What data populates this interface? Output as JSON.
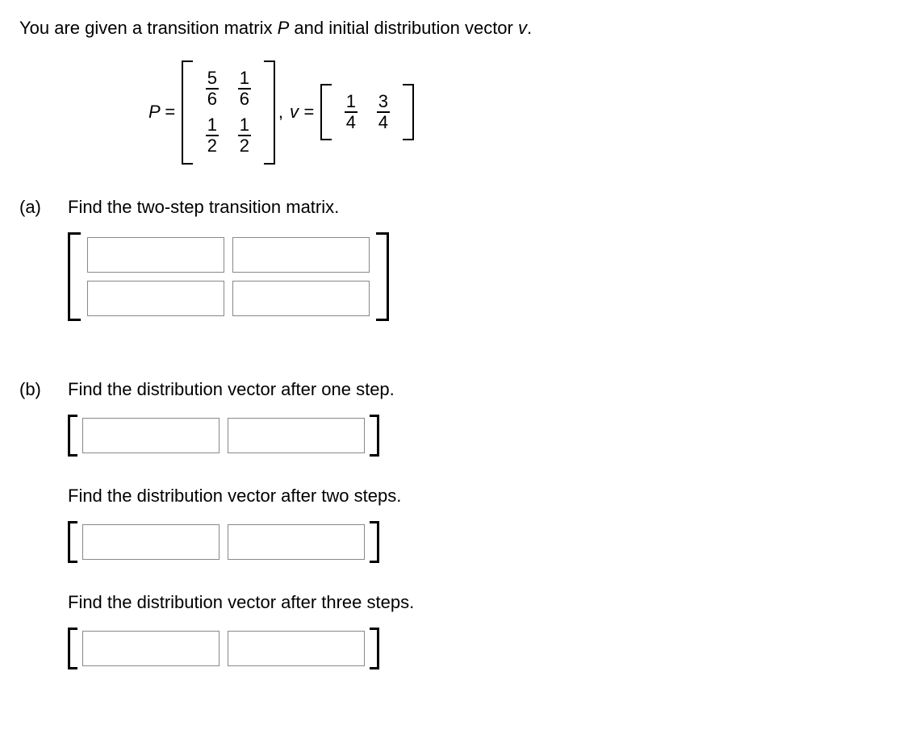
{
  "intro": {
    "prefix": "You are given a transition matrix ",
    "Pvar": "P",
    "mid": " and initial distribution vector ",
    "vvar": "v",
    "suffix": "."
  },
  "setup": {
    "P_label": "P = ",
    "v_label": "v = ",
    "comma": ", ",
    "P": {
      "r1c1": {
        "num": "5",
        "den": "6"
      },
      "r1c2": {
        "num": "1",
        "den": "6"
      },
      "r2c1": {
        "num": "1",
        "den": "2"
      },
      "r2c2": {
        "num": "1",
        "den": "2"
      }
    },
    "v": {
      "c1": {
        "num": "1",
        "den": "4"
      },
      "c2": {
        "num": "3",
        "den": "4"
      }
    }
  },
  "part_a": {
    "label": "(a)",
    "prompt": "Find the two-step transition matrix."
  },
  "part_b": {
    "label": "(b)",
    "prompt1": "Find the distribution vector after one step.",
    "prompt2": "Find the distribution vector after two steps.",
    "prompt3": "Find the distribution vector after three steps."
  }
}
